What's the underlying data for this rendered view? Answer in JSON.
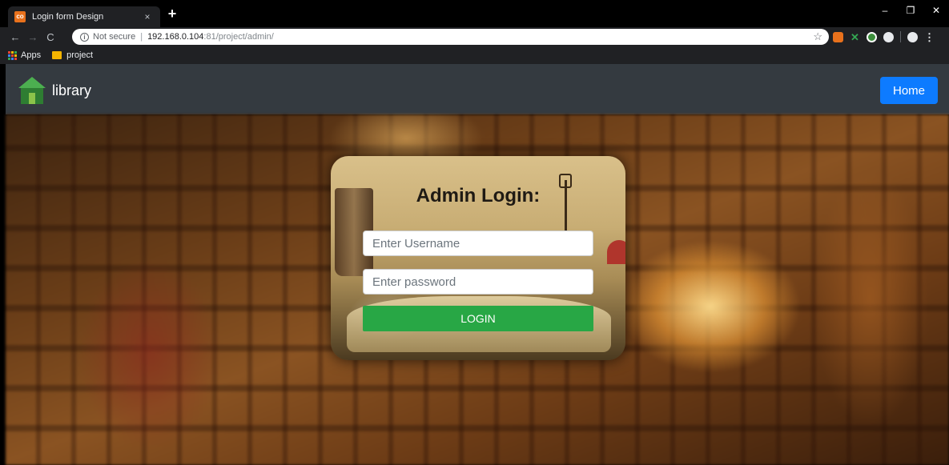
{
  "browser": {
    "tab_title": "Login form Design",
    "tab_favicon_text": "co",
    "tab_close": "×",
    "new_tab": "+",
    "window_controls": {
      "minimize": "–",
      "restore": "❐",
      "close": "✕"
    },
    "nav": {
      "back": "←",
      "forward": "→",
      "reload": "C"
    },
    "address": {
      "security_label": "Not secure",
      "separator": "|",
      "host": "192.168.0.104",
      "rest": ":81/project/admin/"
    },
    "bookmarks": {
      "apps_label": "Apps",
      "folder_label": "project"
    },
    "star_icon": "☆"
  },
  "navbar": {
    "brand": "library",
    "home_button": "Home",
    "home_color": "#0d7bff"
  },
  "login": {
    "title": "Admin Login:",
    "username_placeholder": "Enter Username",
    "password_placeholder": "Enter password",
    "submit_label": "LOGIN",
    "submit_color": "#28a745"
  }
}
